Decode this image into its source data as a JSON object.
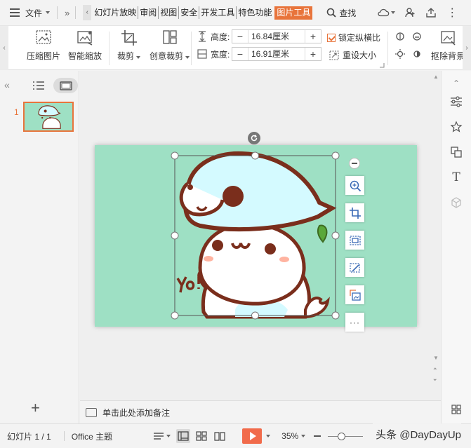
{
  "menubar": {
    "file_label": "文件",
    "tabs": [
      "幻灯片放映",
      "审阅",
      "视图",
      "安全",
      "开发工具",
      "特色功能"
    ],
    "active_tab": "图片工具",
    "search_label": "查找"
  },
  "ribbon": {
    "compress_label": "压缩图片",
    "smart_zoom_label": "智能缩放",
    "crop_label": "裁剪",
    "creative_crop_label": "创意裁剪",
    "height_label": "高度:",
    "height_value": "16.84厘米",
    "width_label": "宽度:",
    "width_value": "16.91厘米",
    "lock_ratio_label": "锁定纵横比",
    "reset_size_label": "重设大小",
    "cutout_label": "抠除背景"
  },
  "slides_panel": {
    "slide_number": "1"
  },
  "notes": {
    "placeholder": "单击此处添加备注"
  },
  "status": {
    "slide_info": "幻灯片 1 / 1",
    "theme": "Office 主题",
    "zoom": "35%"
  },
  "watermark": "头条 @DayDayUp",
  "colors": {
    "accent": "#e8743b",
    "slide_bg": "#9ee0c4",
    "play": "#f16b4b"
  }
}
